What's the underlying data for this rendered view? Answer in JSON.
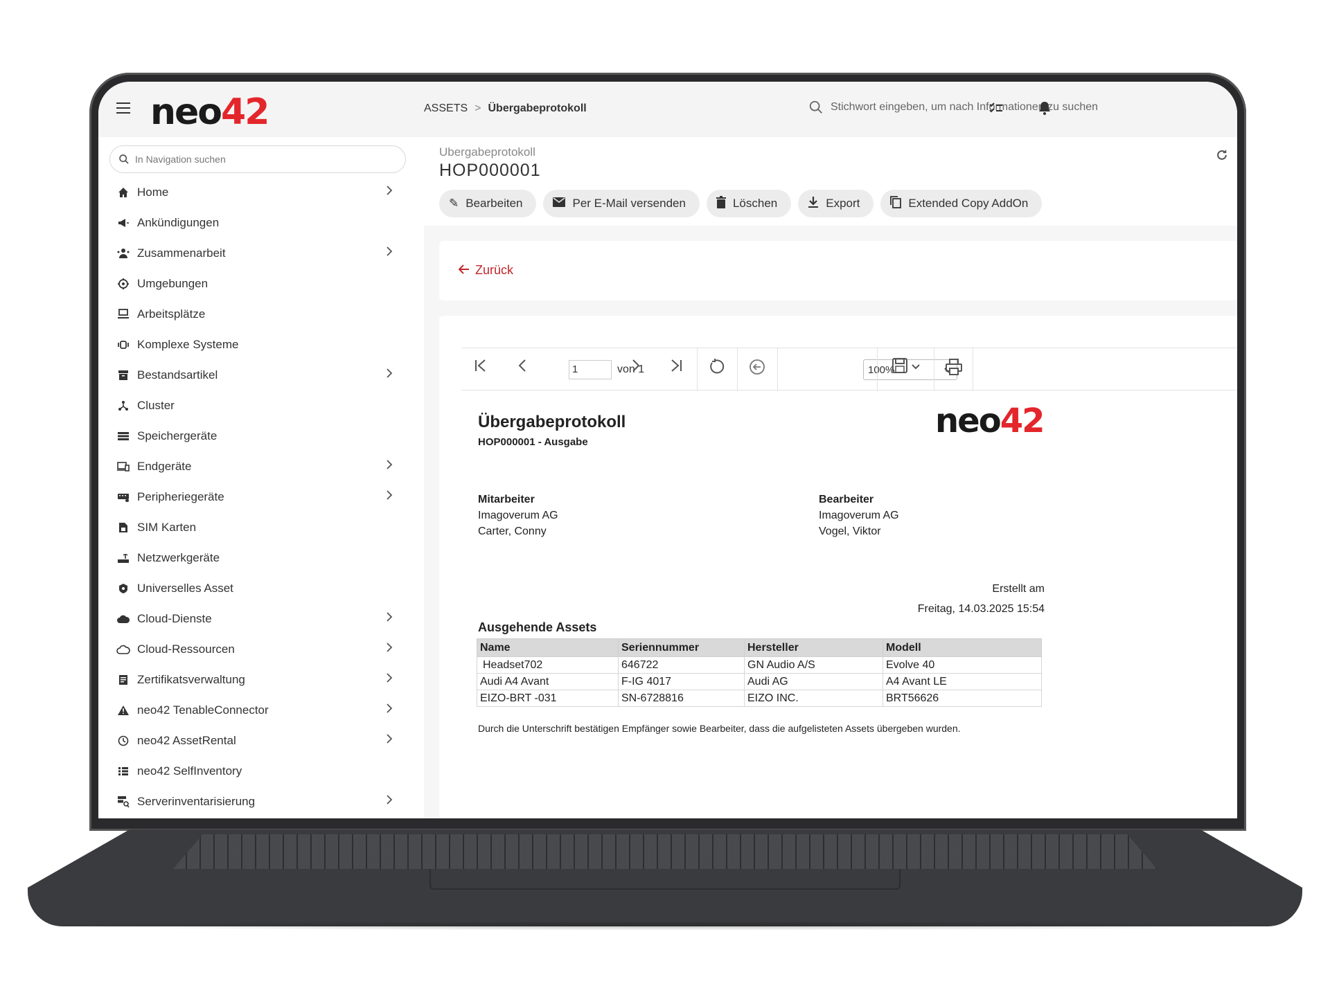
{
  "app": {
    "logo_main": "neo",
    "logo_accent": "42"
  },
  "breadcrumb": {
    "root": "ASSETS",
    "separator": ">",
    "current": "Übergabeprotokoll"
  },
  "top_search": {
    "placeholder": "Stichwort eingeben, um nach Informationen zu suchen"
  },
  "sidebar": {
    "search_placeholder": "In Navigation suchen",
    "items": [
      {
        "label": "Home",
        "icon": "home-icon",
        "chevron": true
      },
      {
        "label": "Ankündigungen",
        "icon": "megaphone-icon",
        "chevron": false
      },
      {
        "label": "Zusammenarbeit",
        "icon": "people-icon",
        "chevron": true
      },
      {
        "label": "Umgebungen",
        "icon": "environment-icon",
        "chevron": false
      },
      {
        "label": "Arbeitsplätze",
        "icon": "workstation-icon",
        "chevron": false
      },
      {
        "label": "Komplexe Systeme",
        "icon": "complex-system-icon",
        "chevron": false
      },
      {
        "label": "Bestandsartikel",
        "icon": "archive-icon",
        "chevron": true
      },
      {
        "label": "Cluster",
        "icon": "cluster-icon",
        "chevron": false
      },
      {
        "label": "Speichergeräte",
        "icon": "storage-icon",
        "chevron": false
      },
      {
        "label": "Endgeräte",
        "icon": "devices-icon",
        "chevron": true
      },
      {
        "label": "Peripheriegeräte",
        "icon": "peripheral-icon",
        "chevron": true
      },
      {
        "label": "SIM Karten",
        "icon": "sim-card-icon",
        "chevron": false
      },
      {
        "label": "Netzwerkgeräte",
        "icon": "router-icon",
        "chevron": false
      },
      {
        "label": "Universelles Asset",
        "icon": "universal-asset-icon",
        "chevron": false
      },
      {
        "label": "Cloud-Dienste",
        "icon": "cloud-filled-icon",
        "chevron": true
      },
      {
        "label": "Cloud-Ressourcen",
        "icon": "cloud-outline-icon",
        "chevron": true
      },
      {
        "label": "Zertifikatsverwaltung",
        "icon": "certificate-icon",
        "chevron": true
      },
      {
        "label": "neo42 TenableConnector",
        "icon": "warning-icon",
        "chevron": true
      },
      {
        "label": "neo42 AssetRental",
        "icon": "rental-icon",
        "chevron": true
      },
      {
        "label": "neo42 SelfInventory",
        "icon": "list-icon",
        "chevron": false
      },
      {
        "label": "Serverinventarisierung",
        "icon": "server-search-icon",
        "chevron": true
      }
    ]
  },
  "header": {
    "subtitle": "Ubergabeprotokoll",
    "title": "HOP000001"
  },
  "actions": {
    "edit": "Bearbeiten",
    "email": "Per E-Mail versenden",
    "delete": "Löschen",
    "export": "Export",
    "copy": "Extended Copy AddOn"
  },
  "back_label": "Zurück",
  "viewer": {
    "page_value": "1",
    "of_label": "von 1",
    "zoom": "100%"
  },
  "document": {
    "title": "Übergabeprotokoll",
    "subtitle": "HOP000001 - Ausgabe",
    "logo_main": "neo",
    "logo_accent": "42",
    "employee_heading": "Mitarbeiter",
    "employee_company": "Imagoverum AG",
    "employee_name": "Carter, Conny",
    "editor_heading": "Bearbeiter",
    "editor_company": "Imagoverum AG",
    "editor_name": "Vogel, Viktor",
    "created_label": "Erstellt am",
    "created_value": "Freitag, 14.03.2025 15:54",
    "assets_heading": "Ausgehende Assets",
    "columns": [
      "Name",
      "Seriennummer",
      "Hersteller",
      "Modell"
    ],
    "rows": [
      [
        "Headset702",
        "646722",
        "GN Audio A/S",
        "Evolve 40"
      ],
      [
        "Audi A4 Avant",
        "F-IG 4017",
        "Audi AG",
        "A4 Avant LE"
      ],
      [
        "EIZO-BRT -031",
        "SN-6728816",
        "EIZO INC.",
        "BRT56626"
      ]
    ],
    "footnote": "Durch die Unterschrift bestätigen Empfänger sowie Bearbeiter, dass die aufgelisteten Assets übergeben wurden."
  },
  "colors": {
    "brand_red": "#e3262b",
    "back_link": "#c0262b",
    "laptop_frame": "#2a2a2c"
  }
}
